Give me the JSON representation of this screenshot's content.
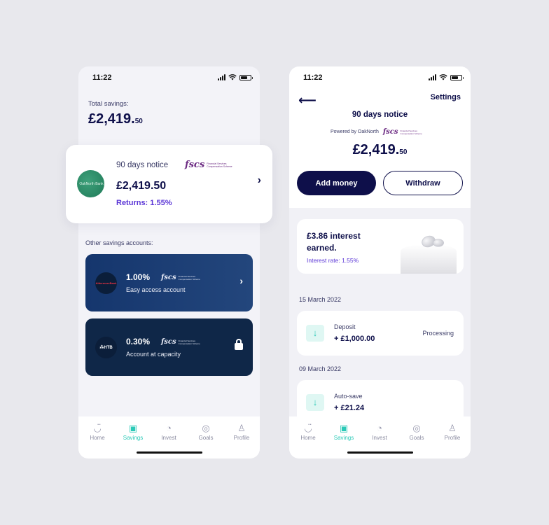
{
  "status_bar": {
    "time": "11:22"
  },
  "savings_screen": {
    "total_label": "Total savings:",
    "total_amount_main": "£2,419.",
    "total_amount_pence": "50",
    "main_account": {
      "bank_logo_text": "OakNorth Bank",
      "title": "90 days notice",
      "amount": "£2,419.50",
      "returns": "Returns: 1.55%",
      "fscs_mark": "fscs",
      "fscs_text": "Financial Services Compensation Scheme"
    },
    "other_label": "Other savings accounts:",
    "accounts": [
      {
        "logo_text": "AldermoreBank",
        "rate": "1.00%",
        "subtitle": "Easy access account",
        "fscs_mark": "fscs",
        "fscs_text": "Financial Services Compensation Scheme"
      },
      {
        "logo_text": "HTB",
        "rate": "0.30%",
        "subtitle": "Account at capacity",
        "fscs_mark": "fscs",
        "fscs_text": "Financial Services Compensation Scheme"
      }
    ]
  },
  "detail_screen": {
    "settings_label": "Settings",
    "title": "90 days notice",
    "powered_by": "Powered by OakNorth",
    "fscs_mark": "fscs",
    "fscs_text": "Financial Services Compensation Scheme",
    "amount_main": "£2,419.",
    "amount_pence": "50",
    "add_money_label": "Add money",
    "withdraw_label": "Withdraw",
    "interest_title": "£3.86 interest earned.",
    "interest_rate": "Interest rate: 1.55%",
    "transactions": [
      {
        "date": "15 March 2022",
        "label": "Deposit",
        "amount": "+ £1,000.00",
        "status": "Processing"
      },
      {
        "date": "09 March 2022",
        "label": "Auto-save",
        "amount": "+ £21.24",
        "status": ""
      }
    ]
  },
  "tabbar": {
    "tabs": [
      {
        "label": "Home",
        "icon": "home-smile-icon"
      },
      {
        "label": "Savings",
        "icon": "wallet-icon"
      },
      {
        "label": "Invest",
        "icon": "pie-chart-icon"
      },
      {
        "label": "Goals",
        "icon": "target-icon"
      },
      {
        "label": "Profile",
        "icon": "user-icon"
      }
    ],
    "active_tab": "Savings",
    "active_color": "#2bc9b7"
  },
  "colors": {
    "navy": "#0e0f4a",
    "accent_purple": "#5a35d6",
    "teal": "#2bc9b7",
    "fscs_purple": "#6b2a82"
  }
}
